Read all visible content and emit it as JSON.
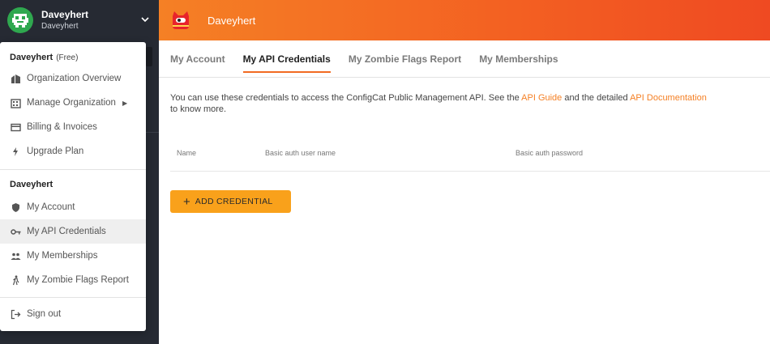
{
  "sidebar": {
    "user_name": "Daveyhert",
    "org_name": "Daveyhert"
  },
  "topbar": {
    "title": "Daveyhert"
  },
  "tabs": [
    {
      "label": "My Account"
    },
    {
      "label": "My API Credentials"
    },
    {
      "label": "My Zombie Flags Report"
    },
    {
      "label": "My Memberships"
    }
  ],
  "content": {
    "description_pre": "You can use these credentials to access the ConfigCat Public Management API. See the ",
    "api_guide_link": "API Guide",
    "description_mid": " and the detailed ",
    "api_doc_link": "API Documentation",
    "description_post": "to know more.",
    "table_headers": [
      "Name",
      "Basic auth user name",
      "Basic auth password"
    ],
    "add_button_label": "ADD CREDENTIAL"
  },
  "menu": {
    "org_title": "Daveyhert",
    "org_plan": "(Free)",
    "org_items": [
      {
        "label": "Organization Overview",
        "icon": "organization-icon"
      },
      {
        "label": "Manage Organization",
        "icon": "manage-organization-icon"
      },
      {
        "label": "Billing & Invoices",
        "icon": "credit-card-icon"
      },
      {
        "label": "Upgrade Plan",
        "icon": "bolt-icon"
      }
    ],
    "user_title": "Daveyhert",
    "user_items": [
      {
        "label": "My Account",
        "icon": "shield-icon"
      },
      {
        "label": "My API Credentials",
        "icon": "key-icon"
      },
      {
        "label": "My Memberships",
        "icon": "people-icon"
      },
      {
        "label": "My Zombie Flags Report",
        "icon": "walking-person-icon"
      }
    ],
    "sign_out_label": "Sign out"
  },
  "colors": {
    "accent": "#f58025",
    "button": "#f9a11b",
    "sidebar_bg": "#262a33"
  }
}
